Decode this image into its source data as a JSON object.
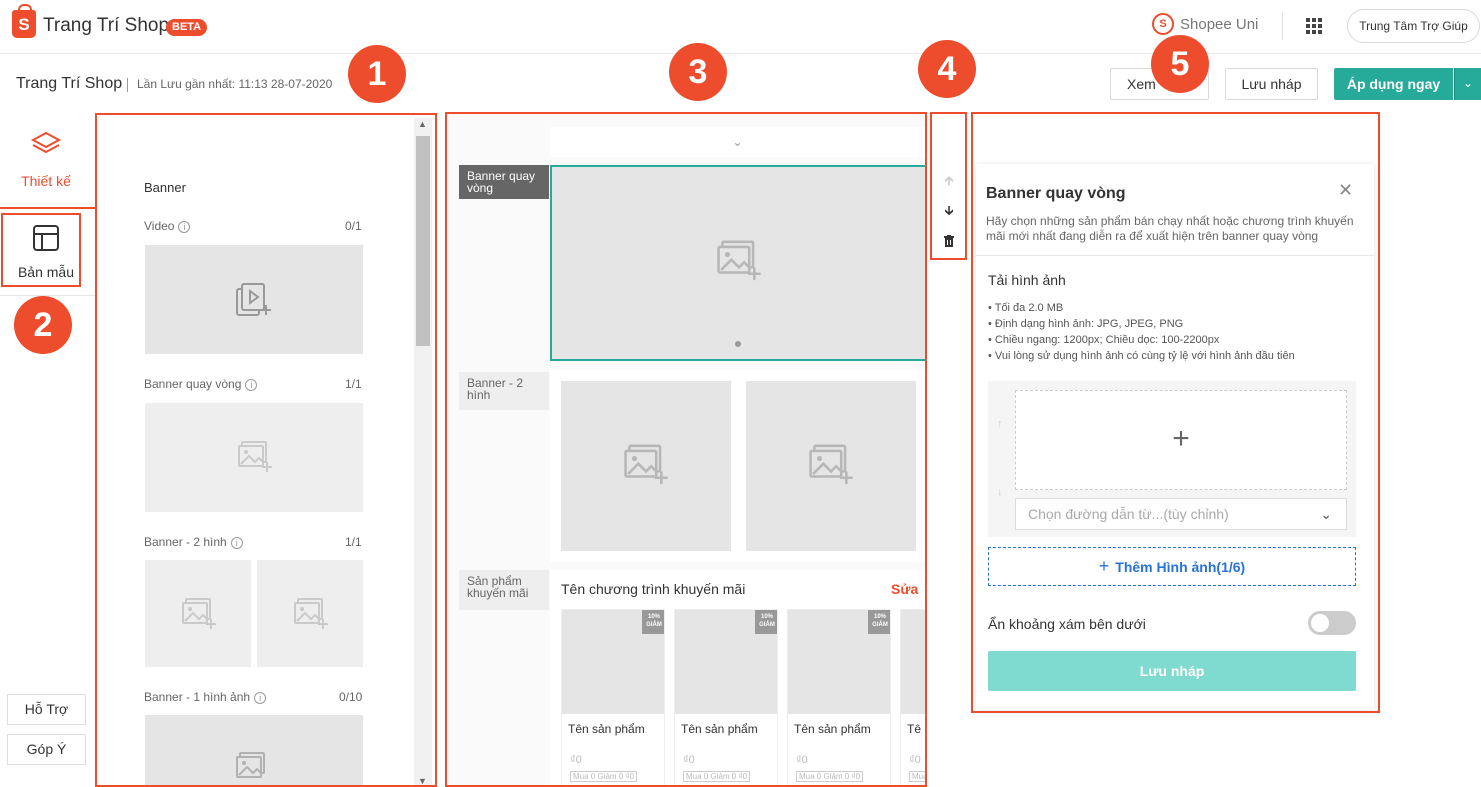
{
  "topbar": {
    "logo_letter": "S",
    "brand": "Trang Trí Shop",
    "beta": "BETA",
    "uni_label": "Shopee Uni",
    "help_center": "Trung Tâm Trợ Giúp"
  },
  "subheader": {
    "title": "Trang Trí Shop",
    "last_saved": "Lần Lưu gần nhất: 11:13 28-07-2020",
    "preview_label": "Xem",
    "save_draft_label": "Lưu nháp",
    "apply_label": "Áp dụng ngay"
  },
  "badges": [
    "1",
    "2",
    "3",
    "4",
    "5"
  ],
  "sidenav": {
    "design_label": "Thiết kế",
    "template_label": "Bản mẫu",
    "support_label": "Hỗ Trợ",
    "feedback_label": "Góp Ý"
  },
  "library": {
    "heading": "Banner",
    "items": [
      {
        "label": "Video",
        "count": "0/1"
      },
      {
        "label": "Banner quay vòng",
        "count": "1/1"
      },
      {
        "label": "Banner - 2 hình",
        "count": "1/1"
      },
      {
        "label": "Banner - 1 hình ảnh",
        "count": "0/10"
      }
    ]
  },
  "canvas": {
    "sections": [
      {
        "label": "Banner quay vòng"
      },
      {
        "label": "Banner - 2 hình"
      },
      {
        "label": "Sản phẩm khuyến mãi"
      }
    ],
    "promo_title": "Tên chương trình khuyến mãi",
    "promo_edit": "Sửa",
    "discount_tag": "10% GIẢM",
    "product_name": "Tên sản phẩm",
    "product_name_cut": "Tê",
    "product_price": "₫0",
    "product_deal": "Mua 0 Giảm 0 ₫0"
  },
  "panel": {
    "title": "Banner quay vòng",
    "description": "Hãy chọn những sản phẩm bán chạy nhất hoặc chương trình khuyến mãi mới nhất đang diễn ra để xuất hiện trên banner quay vòng",
    "upload_heading": "Tải hình ảnh",
    "rules": [
      "Tối đa 2.0 MB",
      "Định dạng hình ảnh: JPG, JPEG, PNG",
      "Chiều ngang: 1200px; Chiều dọc: 100-2200px",
      "Vui lòng sử dụng hình ảnh có cùng tỷ lệ với hình ảnh đầu tiên"
    ],
    "link_placeholder": "Chọn đường dẫn từ...(tùy chỉnh)",
    "add_image": "Thêm Hình ảnh(1/6)",
    "hide_gap_label": "Ẩn khoảng xám bên dưới",
    "hide_gap_on": false,
    "save_label": "Lưu nháp"
  },
  "colors": {
    "brand": "#ee4d2d",
    "accent": "#26aa99",
    "link": "#2673dd"
  }
}
